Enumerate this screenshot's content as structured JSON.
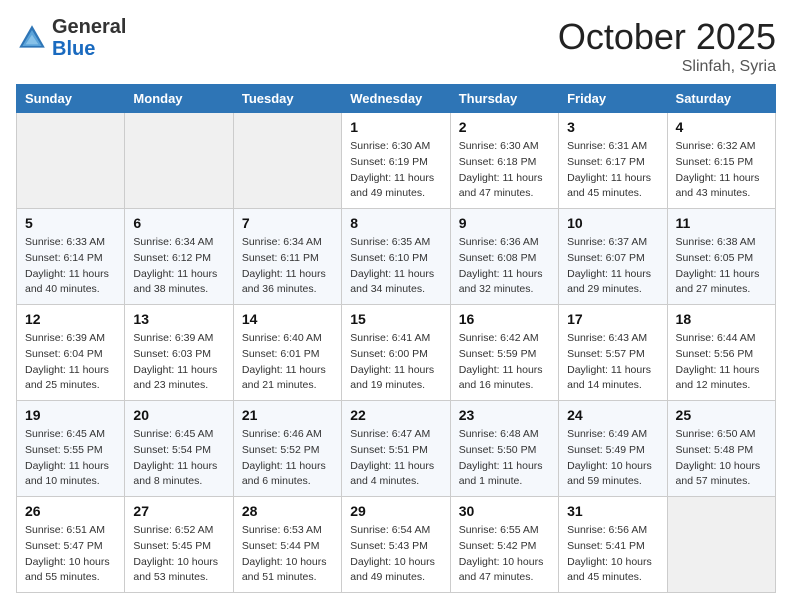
{
  "header": {
    "logo_general": "General",
    "logo_blue": "Blue",
    "month_title": "October 2025",
    "location": "Slinfah, Syria"
  },
  "days_of_week": [
    "Sunday",
    "Monday",
    "Tuesday",
    "Wednesday",
    "Thursday",
    "Friday",
    "Saturday"
  ],
  "weeks": [
    [
      {
        "day": "",
        "sunrise": "",
        "sunset": "",
        "daylight": ""
      },
      {
        "day": "",
        "sunrise": "",
        "sunset": "",
        "daylight": ""
      },
      {
        "day": "",
        "sunrise": "",
        "sunset": "",
        "daylight": ""
      },
      {
        "day": "1",
        "sunrise": "Sunrise: 6:30 AM",
        "sunset": "Sunset: 6:19 PM",
        "daylight": "Daylight: 11 hours and 49 minutes."
      },
      {
        "day": "2",
        "sunrise": "Sunrise: 6:30 AM",
        "sunset": "Sunset: 6:18 PM",
        "daylight": "Daylight: 11 hours and 47 minutes."
      },
      {
        "day": "3",
        "sunrise": "Sunrise: 6:31 AM",
        "sunset": "Sunset: 6:17 PM",
        "daylight": "Daylight: 11 hours and 45 minutes."
      },
      {
        "day": "4",
        "sunrise": "Sunrise: 6:32 AM",
        "sunset": "Sunset: 6:15 PM",
        "daylight": "Daylight: 11 hours and 43 minutes."
      }
    ],
    [
      {
        "day": "5",
        "sunrise": "Sunrise: 6:33 AM",
        "sunset": "Sunset: 6:14 PM",
        "daylight": "Daylight: 11 hours and 40 minutes."
      },
      {
        "day": "6",
        "sunrise": "Sunrise: 6:34 AM",
        "sunset": "Sunset: 6:12 PM",
        "daylight": "Daylight: 11 hours and 38 minutes."
      },
      {
        "day": "7",
        "sunrise": "Sunrise: 6:34 AM",
        "sunset": "Sunset: 6:11 PM",
        "daylight": "Daylight: 11 hours and 36 minutes."
      },
      {
        "day": "8",
        "sunrise": "Sunrise: 6:35 AM",
        "sunset": "Sunset: 6:10 PM",
        "daylight": "Daylight: 11 hours and 34 minutes."
      },
      {
        "day": "9",
        "sunrise": "Sunrise: 6:36 AM",
        "sunset": "Sunset: 6:08 PM",
        "daylight": "Daylight: 11 hours and 32 minutes."
      },
      {
        "day": "10",
        "sunrise": "Sunrise: 6:37 AM",
        "sunset": "Sunset: 6:07 PM",
        "daylight": "Daylight: 11 hours and 29 minutes."
      },
      {
        "day": "11",
        "sunrise": "Sunrise: 6:38 AM",
        "sunset": "Sunset: 6:05 PM",
        "daylight": "Daylight: 11 hours and 27 minutes."
      }
    ],
    [
      {
        "day": "12",
        "sunrise": "Sunrise: 6:39 AM",
        "sunset": "Sunset: 6:04 PM",
        "daylight": "Daylight: 11 hours and 25 minutes."
      },
      {
        "day": "13",
        "sunrise": "Sunrise: 6:39 AM",
        "sunset": "Sunset: 6:03 PM",
        "daylight": "Daylight: 11 hours and 23 minutes."
      },
      {
        "day": "14",
        "sunrise": "Sunrise: 6:40 AM",
        "sunset": "Sunset: 6:01 PM",
        "daylight": "Daylight: 11 hours and 21 minutes."
      },
      {
        "day": "15",
        "sunrise": "Sunrise: 6:41 AM",
        "sunset": "Sunset: 6:00 PM",
        "daylight": "Daylight: 11 hours and 19 minutes."
      },
      {
        "day": "16",
        "sunrise": "Sunrise: 6:42 AM",
        "sunset": "Sunset: 5:59 PM",
        "daylight": "Daylight: 11 hours and 16 minutes."
      },
      {
        "day": "17",
        "sunrise": "Sunrise: 6:43 AM",
        "sunset": "Sunset: 5:57 PM",
        "daylight": "Daylight: 11 hours and 14 minutes."
      },
      {
        "day": "18",
        "sunrise": "Sunrise: 6:44 AM",
        "sunset": "Sunset: 5:56 PM",
        "daylight": "Daylight: 11 hours and 12 minutes."
      }
    ],
    [
      {
        "day": "19",
        "sunrise": "Sunrise: 6:45 AM",
        "sunset": "Sunset: 5:55 PM",
        "daylight": "Daylight: 11 hours and 10 minutes."
      },
      {
        "day": "20",
        "sunrise": "Sunrise: 6:45 AM",
        "sunset": "Sunset: 5:54 PM",
        "daylight": "Daylight: 11 hours and 8 minutes."
      },
      {
        "day": "21",
        "sunrise": "Sunrise: 6:46 AM",
        "sunset": "Sunset: 5:52 PM",
        "daylight": "Daylight: 11 hours and 6 minutes."
      },
      {
        "day": "22",
        "sunrise": "Sunrise: 6:47 AM",
        "sunset": "Sunset: 5:51 PM",
        "daylight": "Daylight: 11 hours and 4 minutes."
      },
      {
        "day": "23",
        "sunrise": "Sunrise: 6:48 AM",
        "sunset": "Sunset: 5:50 PM",
        "daylight": "Daylight: 11 hours and 1 minute."
      },
      {
        "day": "24",
        "sunrise": "Sunrise: 6:49 AM",
        "sunset": "Sunset: 5:49 PM",
        "daylight": "Daylight: 10 hours and 59 minutes."
      },
      {
        "day": "25",
        "sunrise": "Sunrise: 6:50 AM",
        "sunset": "Sunset: 5:48 PM",
        "daylight": "Daylight: 10 hours and 57 minutes."
      }
    ],
    [
      {
        "day": "26",
        "sunrise": "Sunrise: 6:51 AM",
        "sunset": "Sunset: 5:47 PM",
        "daylight": "Daylight: 10 hours and 55 minutes."
      },
      {
        "day": "27",
        "sunrise": "Sunrise: 6:52 AM",
        "sunset": "Sunset: 5:45 PM",
        "daylight": "Daylight: 10 hours and 53 minutes."
      },
      {
        "day": "28",
        "sunrise": "Sunrise: 6:53 AM",
        "sunset": "Sunset: 5:44 PM",
        "daylight": "Daylight: 10 hours and 51 minutes."
      },
      {
        "day": "29",
        "sunrise": "Sunrise: 6:54 AM",
        "sunset": "Sunset: 5:43 PM",
        "daylight": "Daylight: 10 hours and 49 minutes."
      },
      {
        "day": "30",
        "sunrise": "Sunrise: 6:55 AM",
        "sunset": "Sunset: 5:42 PM",
        "daylight": "Daylight: 10 hours and 47 minutes."
      },
      {
        "day": "31",
        "sunrise": "Sunrise: 6:56 AM",
        "sunset": "Sunset: 5:41 PM",
        "daylight": "Daylight: 10 hours and 45 minutes."
      },
      {
        "day": "",
        "sunrise": "",
        "sunset": "",
        "daylight": ""
      }
    ]
  ]
}
